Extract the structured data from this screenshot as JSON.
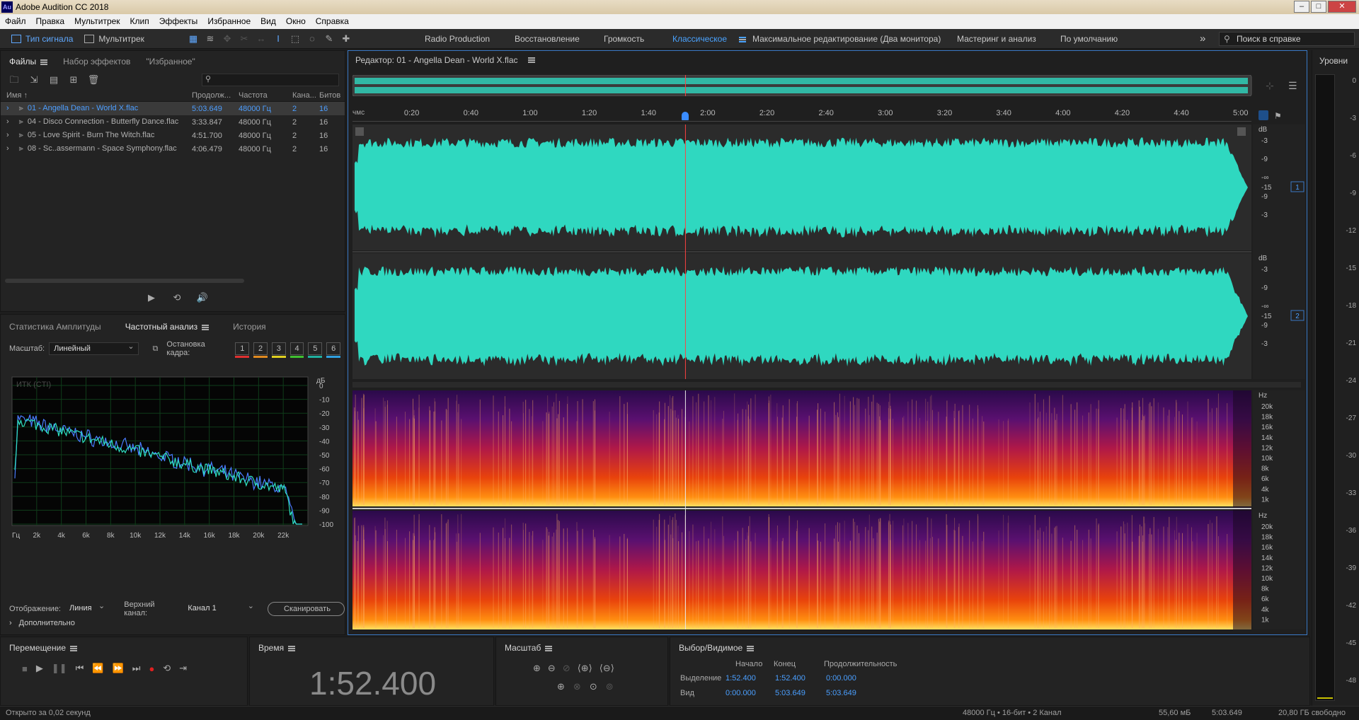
{
  "app": {
    "logo": "Au",
    "title": "Adobe Audition CC 2018"
  },
  "menu": [
    "Файл",
    "Правка",
    "Мультитрек",
    "Клип",
    "Эффекты",
    "Избранное",
    "Вид",
    "Окно",
    "Справка"
  ],
  "toolbar": {
    "mode_waveform": "Тип сигнала",
    "mode_multitrack": "Мультитрек",
    "workspaces": [
      "Radio Production",
      "Восстановление",
      "Громкость",
      "Классическое",
      "Максимальное редактирование (Два монитора)",
      "Мастеринг и анализ",
      "По умолчанию"
    ],
    "active_workspace": "Классическое",
    "more": "»",
    "search_placeholder": "Поиск в справке"
  },
  "files_panel": {
    "tabs": [
      "Файлы",
      "Набор эффектов",
      "\"Избранное\""
    ],
    "columns": {
      "name": "Имя ↑",
      "duration": "Продолж...",
      "rate": "Частота",
      "channels": "Кана...",
      "bits": "Битов"
    },
    "rows": [
      {
        "name": "01 - Angella Dean - World X.flac",
        "duration": "5:03.649",
        "rate": "48000 Гц",
        "channels": "2",
        "bits": "16",
        "selected": true
      },
      {
        "name": "04 - Disco Connection - Butterfly Dance.flac",
        "duration": "3:33.847",
        "rate": "48000 Гц",
        "channels": "2",
        "bits": "16",
        "selected": false
      },
      {
        "name": "05 - Love Spirit - Burn The Witch.flac",
        "duration": "4:51.700",
        "rate": "48000 Гц",
        "channels": "2",
        "bits": "16",
        "selected": false
      },
      {
        "name": "08 - Sc..assermann - Space Symphony.flac",
        "duration": "4:06.479",
        "rate": "48000 Гц",
        "channels": "2",
        "bits": "16",
        "selected": false
      }
    ]
  },
  "analysis_panel": {
    "tabs": [
      "Статистика Амплитуды",
      "Частотный анализ",
      "История"
    ],
    "scale_label": "Масштаб:",
    "scale_value": "Линейный",
    "freeze_label": "Остановка кадра:",
    "freeze_slots": [
      {
        "n": "1",
        "color": "#e03030"
      },
      {
        "n": "2",
        "color": "#e08a20"
      },
      {
        "n": "3",
        "color": "#e0d020"
      },
      {
        "n": "4",
        "color": "#40c030"
      },
      {
        "n": "5",
        "color": "#20b0a0"
      },
      {
        "n": "6",
        "color": "#30a0e0"
      }
    ],
    "graph_label": "ИТК (CTI)",
    "db_unit": "дБ",
    "db_ticks": [
      "0",
      "-10",
      "-20",
      "-30",
      "-40",
      "-50",
      "-60",
      "-70",
      "-80",
      "-90",
      "-100"
    ],
    "freq_ticks": [
      "Гц",
      "2k",
      "4k",
      "6k",
      "8k",
      "10k",
      "12k",
      "14k",
      "16k",
      "18k",
      "20k",
      "22k"
    ],
    "display_label": "Отображение:",
    "display_value": "Линия",
    "top_channel_label": "Верхний канал:",
    "top_channel_value": "Канал 1",
    "scan_button": "Сканировать",
    "advanced": "Дополнительно",
    "colors": {
      "ch1": "#2ee0c0",
      "ch2": "#4a7cff"
    }
  },
  "editor": {
    "title": "Редактор: 01 - Angella Dean - World X.flac",
    "ruler_unit": "чмс",
    "ruler_ticks": [
      "0:20",
      "0:40",
      "1:00",
      "1:20",
      "1:40",
      "2:00",
      "2:20",
      "2:40",
      "3:00",
      "3:20",
      "3:40",
      "4:00",
      "4:20",
      "4:40",
      "5:00"
    ],
    "db_label": "dB",
    "db_ticks": [
      "-3",
      "-9",
      "-∞",
      "-15",
      "-9",
      "-3"
    ],
    "hz_label": "Hz",
    "hz_ticks": [
      "20k",
      "18k",
      "16k",
      "14k",
      "12k",
      "10k",
      "8k",
      "6k",
      "4k",
      "1k"
    ],
    "channel_badges": [
      "1",
      "2"
    ],
    "waveform_color": "#2fd8c0",
    "playhead_time_fraction": 0.3704
  },
  "transport": {
    "title": "Перемещение",
    "time_title": "Время",
    "time_value": "1:52.400",
    "zoom_title": "Масштаб"
  },
  "selection": {
    "title": "Выбор/Видимое",
    "col_start": "Начало",
    "col_end": "Конец",
    "col_duration": "Продолжительность",
    "row_selection": "Выделение",
    "row_view": "Вид",
    "sel_start": "1:52.400",
    "sel_end": "1:52.400",
    "sel_duration": "0:00.000",
    "view_start": "0:00.000",
    "view_end": "5:03.649",
    "view_duration": "5:03.649"
  },
  "levels": {
    "title": "Уровни",
    "ticks": [
      "0",
      "-3",
      "-6",
      "-9",
      "-12",
      "-15",
      "-18",
      "-21",
      "-24",
      "-27",
      "-30",
      "-33",
      "-36",
      "-39",
      "-42",
      "-45",
      "-48"
    ]
  },
  "status": {
    "left": "Открыто за 0,02 секунд",
    "format": "48000 Гц • 16-бит • 2 Канал",
    "size": "55,60 мБ",
    "duration": "5:03.649",
    "free": "20,80 ГБ свободно"
  }
}
